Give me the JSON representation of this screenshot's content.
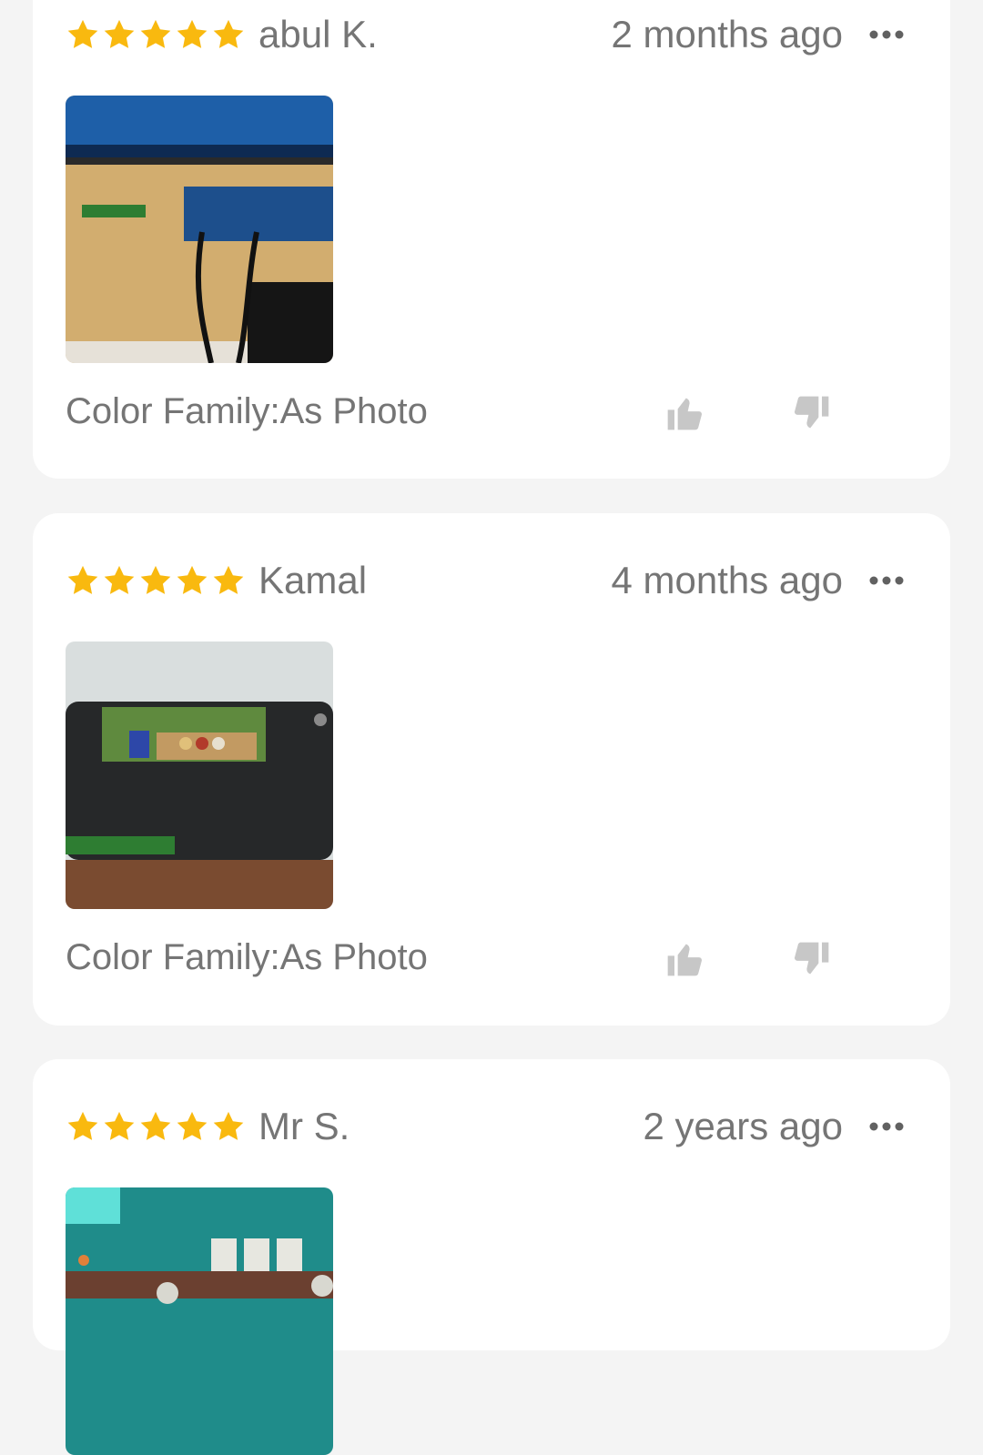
{
  "reviews": [
    {
      "rating": 5,
      "reviewer": "abul K.",
      "time": "2 months ago",
      "variant": "Color Family:As Photo",
      "photo_icon": "product-photo-board-on-desk"
    },
    {
      "rating": 5,
      "reviewer": "Kamal",
      "time": "4 months ago",
      "variant": "Color Family:As Photo",
      "photo_icon": "product-photo-board-on-laptop"
    },
    {
      "rating": 5,
      "reviewer": "Mr S.",
      "time": "2 years ago",
      "photo_icon": "product-photo-wall-sockets"
    }
  ],
  "icons": {
    "star": "star-icon",
    "more": "more-options-icon",
    "like": "thumbs-up-icon",
    "dislike": "thumbs-down-icon"
  },
  "colors": {
    "star": "#f9b90f",
    "text_secondary": "#757575",
    "vote_icon": "#c7c7c7",
    "card_bg": "#ffffff",
    "page_bg": "#f4f4f4"
  }
}
